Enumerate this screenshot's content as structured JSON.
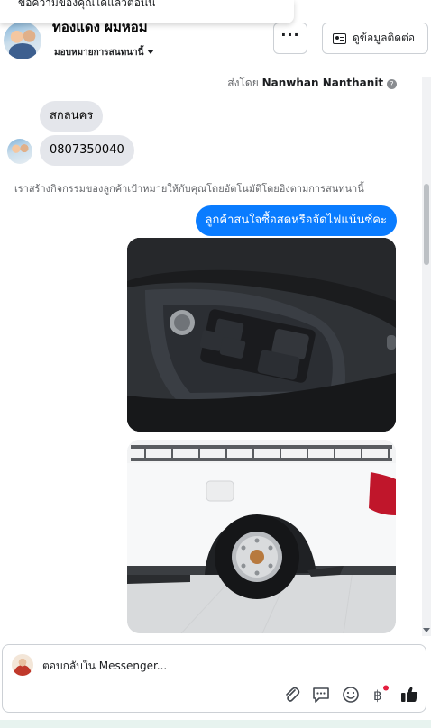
{
  "toast": {
    "text": "ข้อความของคุณได้แล้วตอนนี้"
  },
  "header": {
    "contact_name": "ทองแดง ผมหอม",
    "assign_label": "มอบหมายการสนทนานี้",
    "more_label": "···",
    "contact_info_label": "ดูข้อมูลติดต่อ"
  },
  "thread": {
    "sent_by_prefix": "ส่งโดย",
    "sent_by_name": "Nanwhan Nanthanit",
    "messages_in": [
      {
        "text": "สกลนคร"
      },
      {
        "text": "0807350040"
      }
    ],
    "system_note": "เราสร้างกิจกรรมของลูกค้าเป้าหมายให้กับคุณโดยอัตโนมัติโดยอิงตามการสนทนานี้",
    "message_out": {
      "text": "ลูกค้าสนใจซื้อสดหรือจัดไฟแน้นซ์คะ"
    }
  },
  "composer": {
    "placeholder": "ตอบกลับใน Messenger..."
  },
  "icons": {
    "attach": "paperclip-icon",
    "sticker": "message-bubble-icon",
    "emoji": "smile-icon",
    "payment": "baht-icon",
    "like": "thumbs-up-icon"
  },
  "colors": {
    "outgoing_bubble": "#0a7cff",
    "incoming_bubble": "#e4e6eb",
    "notification_dot": "#e41e3f"
  }
}
